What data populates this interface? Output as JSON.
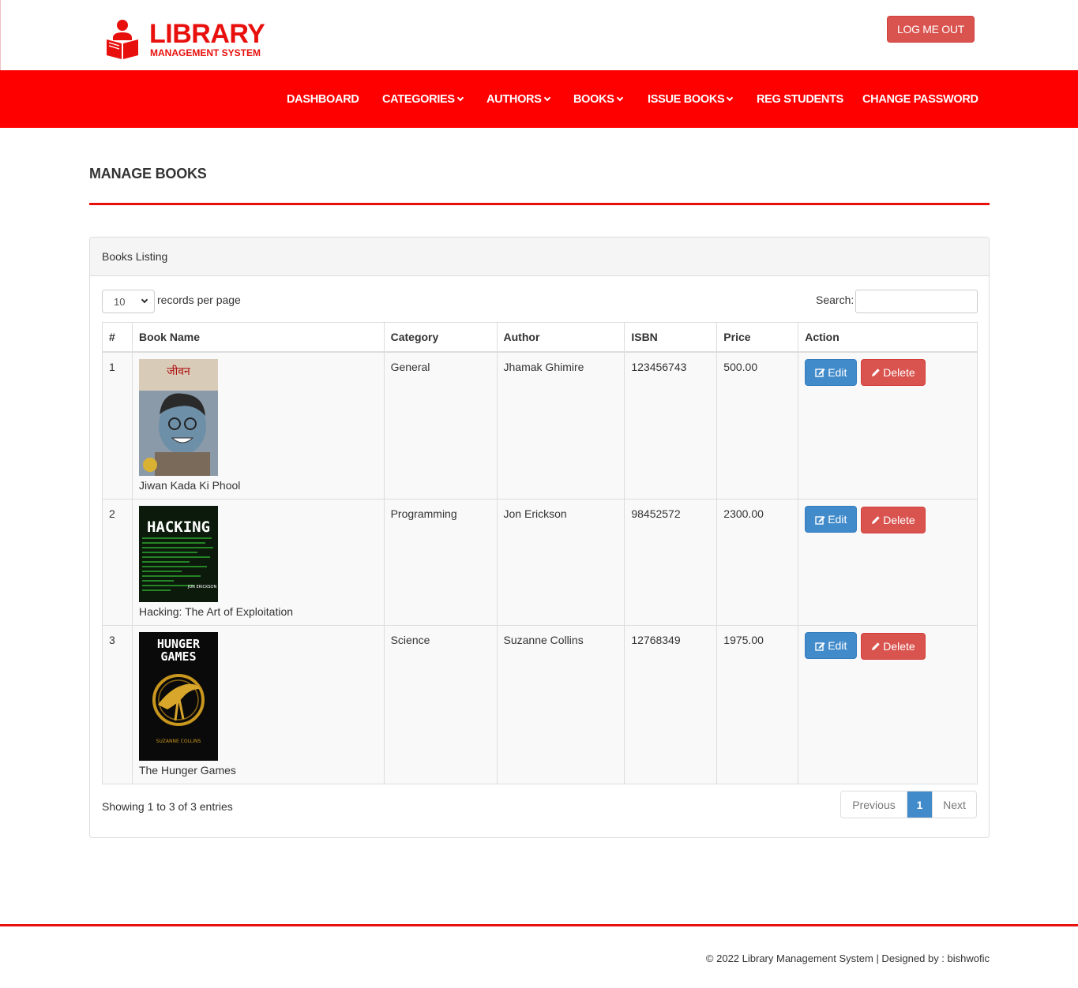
{
  "header": {
    "logo_title": "LIBRARY",
    "logo_subtitle": "MANAGEMENT SYSTEM",
    "logout_label": "LOG ME OUT"
  },
  "nav": {
    "items": [
      {
        "label": "DASHBOARD",
        "dropdown": false
      },
      {
        "label": "CATEGORIES",
        "dropdown": true
      },
      {
        "label": "AUTHORS",
        "dropdown": true
      },
      {
        "label": "BOOKS",
        "dropdown": true
      },
      {
        "label": "ISSUE BOOKS",
        "dropdown": true
      },
      {
        "label": "REG STUDENTS",
        "dropdown": false
      },
      {
        "label": "CHANGE PASSWORD",
        "dropdown": false
      }
    ]
  },
  "page": {
    "title": "MANAGE BOOKS"
  },
  "panel": {
    "heading": "Books Listing",
    "length_value": "10",
    "length_label": "records per page",
    "search_label": "Search:",
    "search_value": ""
  },
  "table": {
    "columns": [
      "#",
      "Book Name",
      "Category",
      "Author",
      "ISBN",
      "Price",
      "Action"
    ],
    "rows": [
      {
        "num": "1",
        "name": "Jiwan Kada Ki Phool",
        "category": "General",
        "author": "Jhamak Ghimire",
        "isbn": "123456743",
        "price": "500.00",
        "cover_icon": "book-cover-portrait"
      },
      {
        "num": "2",
        "name": "Hacking: The Art of Exploitation",
        "category": "Programming",
        "author": "Jon Erickson",
        "isbn": "98452572",
        "price": "2300.00",
        "cover_icon": "book-cover-hacking"
      },
      {
        "num": "3",
        "name": "The Hunger Games",
        "category": "Science",
        "author": "Suzanne Collins",
        "isbn": "12768349",
        "price": "1975.00",
        "cover_icon": "book-cover-hunger-games"
      }
    ],
    "edit_label": "Edit",
    "delete_label": "Delete"
  },
  "pagination": {
    "info": "Showing 1 to 3 of 3 entries",
    "previous": "Previous",
    "current": "1",
    "next": "Next"
  },
  "footer": {
    "text": "© 2022 Library Management System | Designed by : bishwofic"
  },
  "colors": {
    "brand_red": "#ff0000",
    "logo_red": "#e8100d",
    "edit_blue": "#428bca",
    "delete_red": "#d9534f"
  }
}
